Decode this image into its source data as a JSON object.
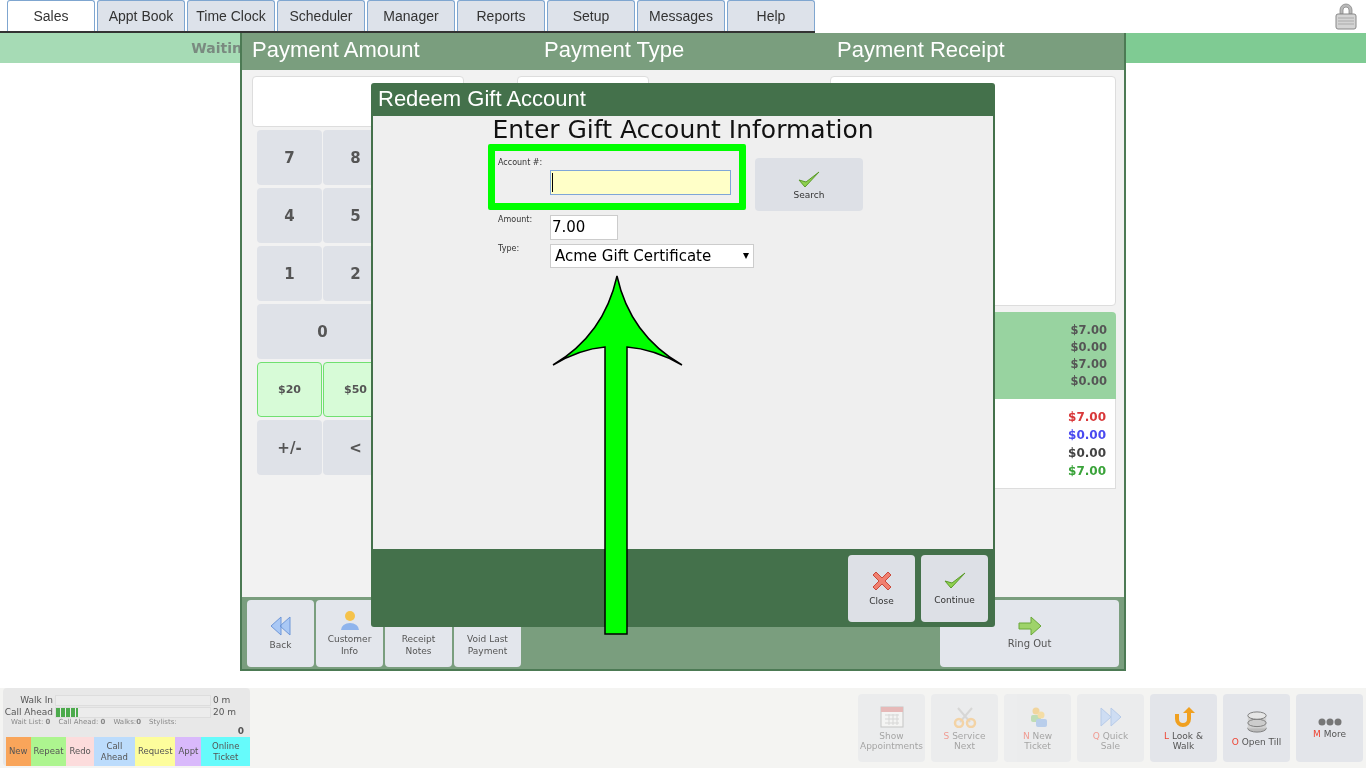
{
  "tabs": [
    {
      "label": "Sales",
      "selected": true
    },
    {
      "label": "Appt Book",
      "selected": false
    },
    {
      "label": "Time Clock",
      "selected": false
    },
    {
      "label": "Scheduler",
      "selected": false
    },
    {
      "label": "Manager",
      "selected": false
    },
    {
      "label": "Reports",
      "selected": false
    },
    {
      "label": "Setup",
      "selected": false
    },
    {
      "label": "Messages",
      "selected": false
    },
    {
      "label": "Help",
      "selected": false
    }
  ],
  "wait_banner": {
    "label": "Waitin"
  },
  "payment": {
    "titles": [
      "Payment Amount",
      "Payment Type",
      "Payment Receipt"
    ],
    "keypad": [
      {
        "label": "7",
        "kind": "key"
      },
      {
        "label": "8",
        "kind": "key"
      },
      {
        "label": "4",
        "kind": "key"
      },
      {
        "label": "5",
        "kind": "key"
      },
      {
        "label": "1",
        "kind": "key"
      },
      {
        "label": "2",
        "kind": "key"
      },
      {
        "label": "0",
        "kind": "wide"
      },
      {
        "label": "$20",
        "kind": "cash"
      },
      {
        "label": "$50",
        "kind": "cash"
      },
      {
        "label": "+/-",
        "kind": "key"
      },
      {
        "label": "<",
        "kind": "key"
      }
    ],
    "summary_values": [
      "$7.00",
      "$0.00",
      "$7.00",
      "$0.00"
    ],
    "balance_values": [
      {
        "text": "$7.00",
        "color": "#d9383a"
      },
      {
        "text": "$0.00",
        "color": "#4a4af0"
      },
      {
        "text": "$0.00",
        "color": "#444444"
      },
      {
        "text": "$7.00",
        "color": "#3aa33a"
      }
    ],
    "actions": [
      {
        "label": "Back",
        "kind": "back"
      },
      {
        "label": "Customer Info",
        "kind": "customer"
      },
      {
        "label": "Receipt Notes"
      },
      {
        "label": "Void Last Payment"
      }
    ],
    "ring_out": "Ring Out"
  },
  "dialog": {
    "title": "Redeem Gift Account",
    "heading": "Enter Gift Account Information",
    "account_label": "Account #:",
    "search": "Search",
    "amount_label": "Amount:",
    "amount": "7.00",
    "type_label": "Type:",
    "type": "Acme Gift Certificate",
    "buttons": [
      {
        "label": "Close",
        "kind": "close"
      },
      {
        "label": "Continue",
        "kind": "continue"
      }
    ]
  },
  "wait_widget": {
    "queues": [
      {
        "label": "Walk In",
        "time": "0 m"
      },
      {
        "label": "Call Ahead",
        "level": 0.14,
        "time": "20 m"
      }
    ],
    "stats": [
      "Wait List: **0**",
      "Call Ahead: **0**",
      "Walks:**0**",
      "Stylists:"
    ],
    "stylists_count": "0",
    "tags": [
      {
        "label": "New",
        "color": "#f9a55a"
      },
      {
        "label": "Repeat",
        "color": "#adf58f"
      },
      {
        "label": "Redo",
        "color": "#fcdcdc"
      },
      {
        "label": "Call Ahead",
        "color": "#bcdcfc"
      },
      {
        "label": "Request",
        "color": "#fdfd9c"
      },
      {
        "label": "Appt",
        "color": "#d9b9fb"
      },
      {
        "label": "Online Ticket",
        "color": "#66fbfb"
      }
    ]
  },
  "quick_actions": [
    {
      "label": "Show Appointments",
      "kind": "calendar",
      "disabled": true
    },
    {
      "key": "S",
      "label": "Service Next",
      "kind": "scissors",
      "disabled": true
    },
    {
      "key": "N",
      "label": "New Ticket",
      "kind": "people",
      "disabled": true
    },
    {
      "key": "Q",
      "label": "Quick Sale",
      "kind": "forward",
      "disabled": true
    },
    {
      "key": "L",
      "label": "Look & Walk",
      "kind": "uturn",
      "disabled": false
    },
    {
      "key": "O",
      "label": "Open Till",
      "kind": "database",
      "disabled": false
    },
    {
      "key": "M",
      "label": "More",
      "kind": "dots",
      "disabled": false
    }
  ]
}
